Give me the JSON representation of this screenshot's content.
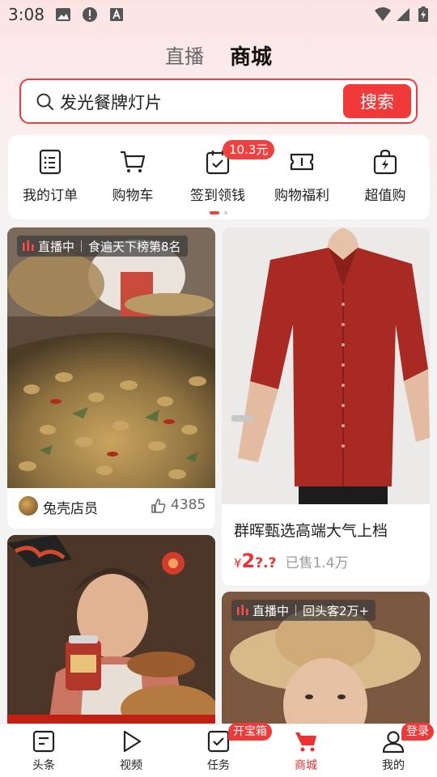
{
  "status_bar": {
    "time": "3:08"
  },
  "top_tabs": {
    "live": "直播",
    "mall": "商城"
  },
  "search": {
    "query": "发光餐牌灯片",
    "button": "搜索"
  },
  "quick_menu": {
    "items": [
      {
        "label": "我的订单",
        "icon": "order-list-icon"
      },
      {
        "label": "购物车",
        "icon": "cart-icon"
      },
      {
        "label": "签到领钱",
        "icon": "calendar-check-icon"
      },
      {
        "label": "购物福利",
        "icon": "coupon-icon"
      },
      {
        "label": "超值购",
        "icon": "bag-bolt-icon"
      }
    ],
    "badge": "10.3元"
  },
  "feed": {
    "card1": {
      "live_label": "直播中",
      "rank": "食遍天下榜第8名",
      "shop": "兔壳店员",
      "likes": "4385"
    },
    "card2": {
      "title": "群晖甄选高端大气上档",
      "price_symbol": "¥",
      "price_main": "2",
      "price_rest": "?.?",
      "sold": "已售1.4万"
    },
    "card4": {
      "live_label": "直播中",
      "tag": "回头客2万+"
    }
  },
  "bottom_nav": {
    "items": [
      {
        "label": "头条",
        "icon": "headline-icon"
      },
      {
        "label": "视频",
        "icon": "play-icon"
      },
      {
        "label": "任务",
        "icon": "task-icon"
      },
      {
        "label": "商城",
        "icon": "mall-cart-icon"
      },
      {
        "label": "我的",
        "icon": "profile-icon"
      }
    ],
    "task_badge": "开宝箱",
    "profile_badge": "登录",
    "active": "商城"
  },
  "colors": {
    "accent": "#f03a3a",
    "background": "#f3f3f3"
  }
}
